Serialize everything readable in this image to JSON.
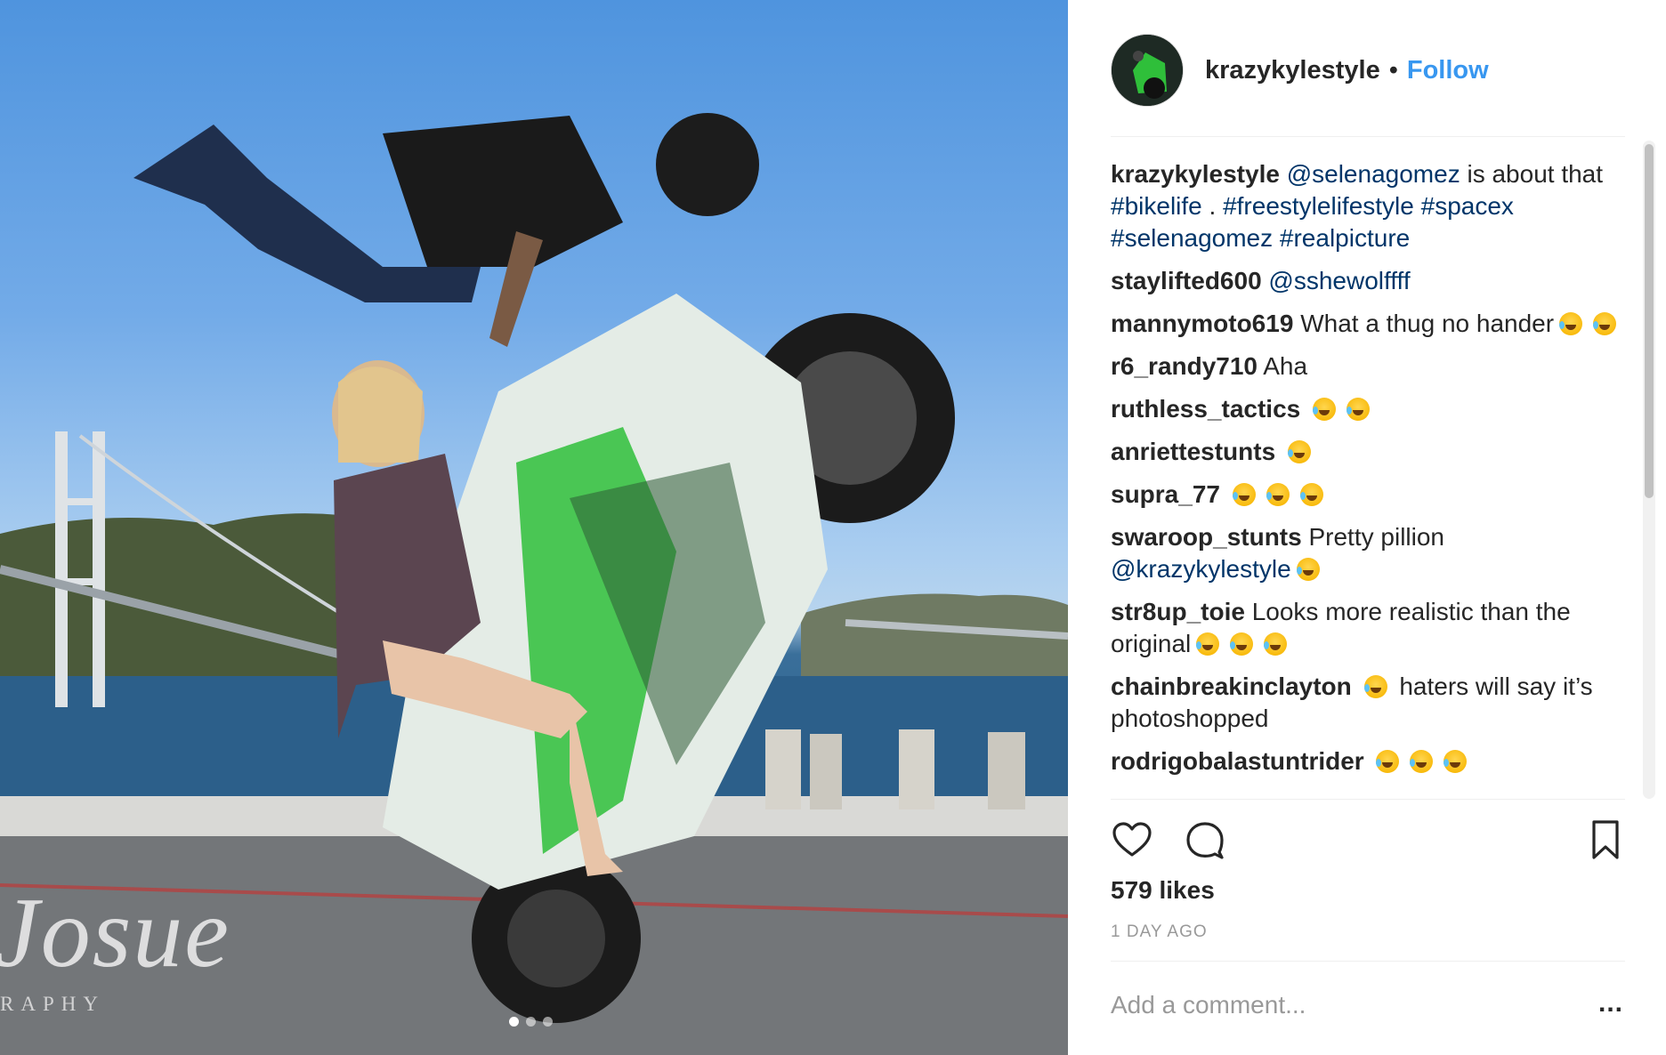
{
  "photo": {
    "watermark_main": "Josue",
    "watermark_sub": "RAPHY",
    "carousel": {
      "count": 3,
      "active": 0
    }
  },
  "post": {
    "username": "krazykylestyle",
    "separator": "•",
    "follow_label": "Follow",
    "likes": "579 likes",
    "time_ago": "1 DAY AGO",
    "comment_placeholder": "Add a comment...",
    "more_label": "..."
  },
  "comments": [
    {
      "author": "krazykylestyle",
      "parts": [
        {
          "t": "link",
          "v": "@selenagomez"
        },
        {
          "t": "text",
          "v": " is about that "
        },
        {
          "t": "link",
          "v": "#bikelife"
        },
        {
          "t": "text",
          "v": " . "
        },
        {
          "t": "link",
          "v": "#freestylelifestyle"
        },
        {
          "t": "text",
          "v": " "
        },
        {
          "t": "link",
          "v": "#spacex"
        },
        {
          "t": "text",
          "v": " "
        },
        {
          "t": "link",
          "v": "#selenagomez"
        },
        {
          "t": "text",
          "v": " "
        },
        {
          "t": "link",
          "v": "#realpicture"
        }
      ]
    },
    {
      "author": "staylifted600",
      "parts": [
        {
          "t": "link",
          "v": "@sshewolffff"
        }
      ]
    },
    {
      "author": "mannymoto619",
      "parts": [
        {
          "t": "text",
          "v": "What a thug no hander"
        },
        {
          "t": "emoji",
          "v": "2"
        }
      ]
    },
    {
      "author": "r6_randy710",
      "parts": [
        {
          "t": "text",
          "v": "Aha"
        }
      ]
    },
    {
      "author": "ruthless_tactics",
      "parts": [
        {
          "t": "emoji",
          "v": "2"
        }
      ]
    },
    {
      "author": "anriettestunts",
      "parts": [
        {
          "t": "emoji",
          "v": "1"
        }
      ]
    },
    {
      "author": "supra_77",
      "parts": [
        {
          "t": "emoji",
          "v": "3"
        }
      ]
    },
    {
      "author": "swaroop_stunts",
      "parts": [
        {
          "t": "text",
          "v": "Pretty pillion "
        },
        {
          "t": "link",
          "v": "@krazykylestyle"
        },
        {
          "t": "emoji",
          "v": "1"
        }
      ]
    },
    {
      "author": "str8up_toie",
      "parts": [
        {
          "t": "text",
          "v": "Looks more realistic than the original"
        },
        {
          "t": "emoji",
          "v": "3"
        }
      ]
    },
    {
      "author": "chainbreakinclayton",
      "parts": [
        {
          "t": "emoji",
          "v": "1"
        },
        {
          "t": "text",
          "v": " haters will say it’s photoshopped"
        }
      ]
    },
    {
      "author": "rodrigobalastuntrider",
      "parts": [
        {
          "t": "emoji",
          "v": "3"
        }
      ]
    }
  ],
  "icons": {
    "like": "heart-icon",
    "comment": "speech-bubble-icon",
    "save": "bookmark-icon"
  },
  "colors": {
    "link": "#003569",
    "follow": "#3897f0",
    "muted": "#999999"
  }
}
